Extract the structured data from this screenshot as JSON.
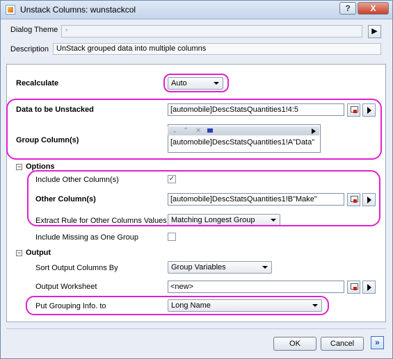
{
  "window": {
    "title": "Unstack Columns: wunstackcol",
    "help_label": "?",
    "close_label": "X"
  },
  "header": {
    "dialog_theme_label": "Dialog Theme",
    "dialog_theme_value": "*",
    "theme_button_label": "▶",
    "description_label": "Description",
    "description_value": "UnStack grouped data into multiple columns"
  },
  "form": {
    "recalculate_label": "Recalculate",
    "recalculate_value": "Auto",
    "data_label": "Data to be Unstacked",
    "data_value": "[automobile]DescStatsQuantities1!4:5",
    "group_label": "Group Column(s)",
    "group_value": "[automobile]DescStatsQuantities1!A\"Data\"",
    "group_toolbar_icons": [
      "down-chevron-icon",
      "up-chevron-icon",
      "remove-x-icon",
      "column-icon",
      "play-icon"
    ],
    "options": {
      "toggle": "−",
      "label": "Options",
      "include_other_label": "Include Other Column(s)",
      "include_other_checked": "✓",
      "other_columns_label": "Other Column(s)",
      "other_columns_value": "[automobile]DescStatsQuantities1!B\"Make\"",
      "extract_rule_label": "Extract Rule for Other Columns Values",
      "extract_rule_value": "Matching Longest Group",
      "include_missing_label": "Include Missing as One Group",
      "include_missing_checked": ""
    },
    "output": {
      "toggle": "−",
      "label": "Output",
      "sort_label": "Sort Output Columns By",
      "sort_value": "Group Variables",
      "worksheet_label": "Output Worksheet",
      "worksheet_value": "<new>",
      "grouping_info_label": "Put Grouping Info. to",
      "grouping_info_value": "Long Name"
    }
  },
  "footer": {
    "ok_label": "OK",
    "cancel_label": "Cancel",
    "more_label": "»"
  },
  "colors": {
    "highlight": "#e020d0",
    "accent": "#1d54a8"
  }
}
